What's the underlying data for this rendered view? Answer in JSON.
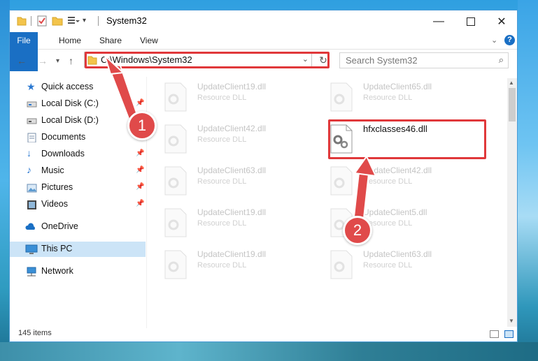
{
  "window": {
    "title": "System32"
  },
  "ribbon": {
    "tabs": [
      "File",
      "Home",
      "Share",
      "View"
    ]
  },
  "address": {
    "path": "C:\\Windows\\System32"
  },
  "search": {
    "placeholder": "Search System32"
  },
  "sidebar": {
    "items": [
      {
        "label": "Quick access",
        "icon": "star-icon",
        "pinned": false
      },
      {
        "label": "Local Disk (C:)",
        "icon": "drive-icon",
        "pinned": true
      },
      {
        "label": "Local Disk (D:)",
        "icon": "drive-icon",
        "pinned": true
      },
      {
        "label": "Documents",
        "icon": "documents-icon",
        "pinned": true
      },
      {
        "label": "Downloads",
        "icon": "download-icon",
        "pinned": true
      },
      {
        "label": "Music",
        "icon": "music-icon",
        "pinned": true
      },
      {
        "label": "Pictures",
        "icon": "pictures-icon",
        "pinned": true
      },
      {
        "label": "Videos",
        "icon": "videos-icon",
        "pinned": true
      },
      {
        "label": "OneDrive",
        "icon": "cloud-icon",
        "pinned": false
      },
      {
        "label": "This PC",
        "icon": "computer-icon",
        "pinned": false
      },
      {
        "label": "Network",
        "icon": "network-icon",
        "pinned": false
      }
    ]
  },
  "files": [
    {
      "name": "UpdateClient19.dll",
      "type": "Resource DLL"
    },
    {
      "name": "UpdateClient65.dll",
      "type": "Resource DLL"
    },
    {
      "name": "UpdateClient42.dll",
      "type": "Resource DLL"
    },
    {
      "name": "hfxclasses46.dll",
      "type": ""
    },
    {
      "name": "UpdateClient63.dll",
      "type": "Resource DLL"
    },
    {
      "name": "UpdateClient42.dll",
      "type": "Resource DLL"
    },
    {
      "name": "UpdateClient19.dll",
      "type": "Resource DLL"
    },
    {
      "name": "UpdateClient5.dll",
      "type": "Resource DLL"
    },
    {
      "name": "UpdateClient19.dll",
      "type": "Resource DLL"
    },
    {
      "name": "UpdateClient63.dll",
      "type": "Resource DLL"
    }
  ],
  "status": {
    "item_count": "145 items"
  },
  "callouts": [
    "1",
    "2"
  ],
  "colors": {
    "accent": "#1a6fc4",
    "annotation": "#e0383a",
    "selection": "#cce4f7"
  }
}
